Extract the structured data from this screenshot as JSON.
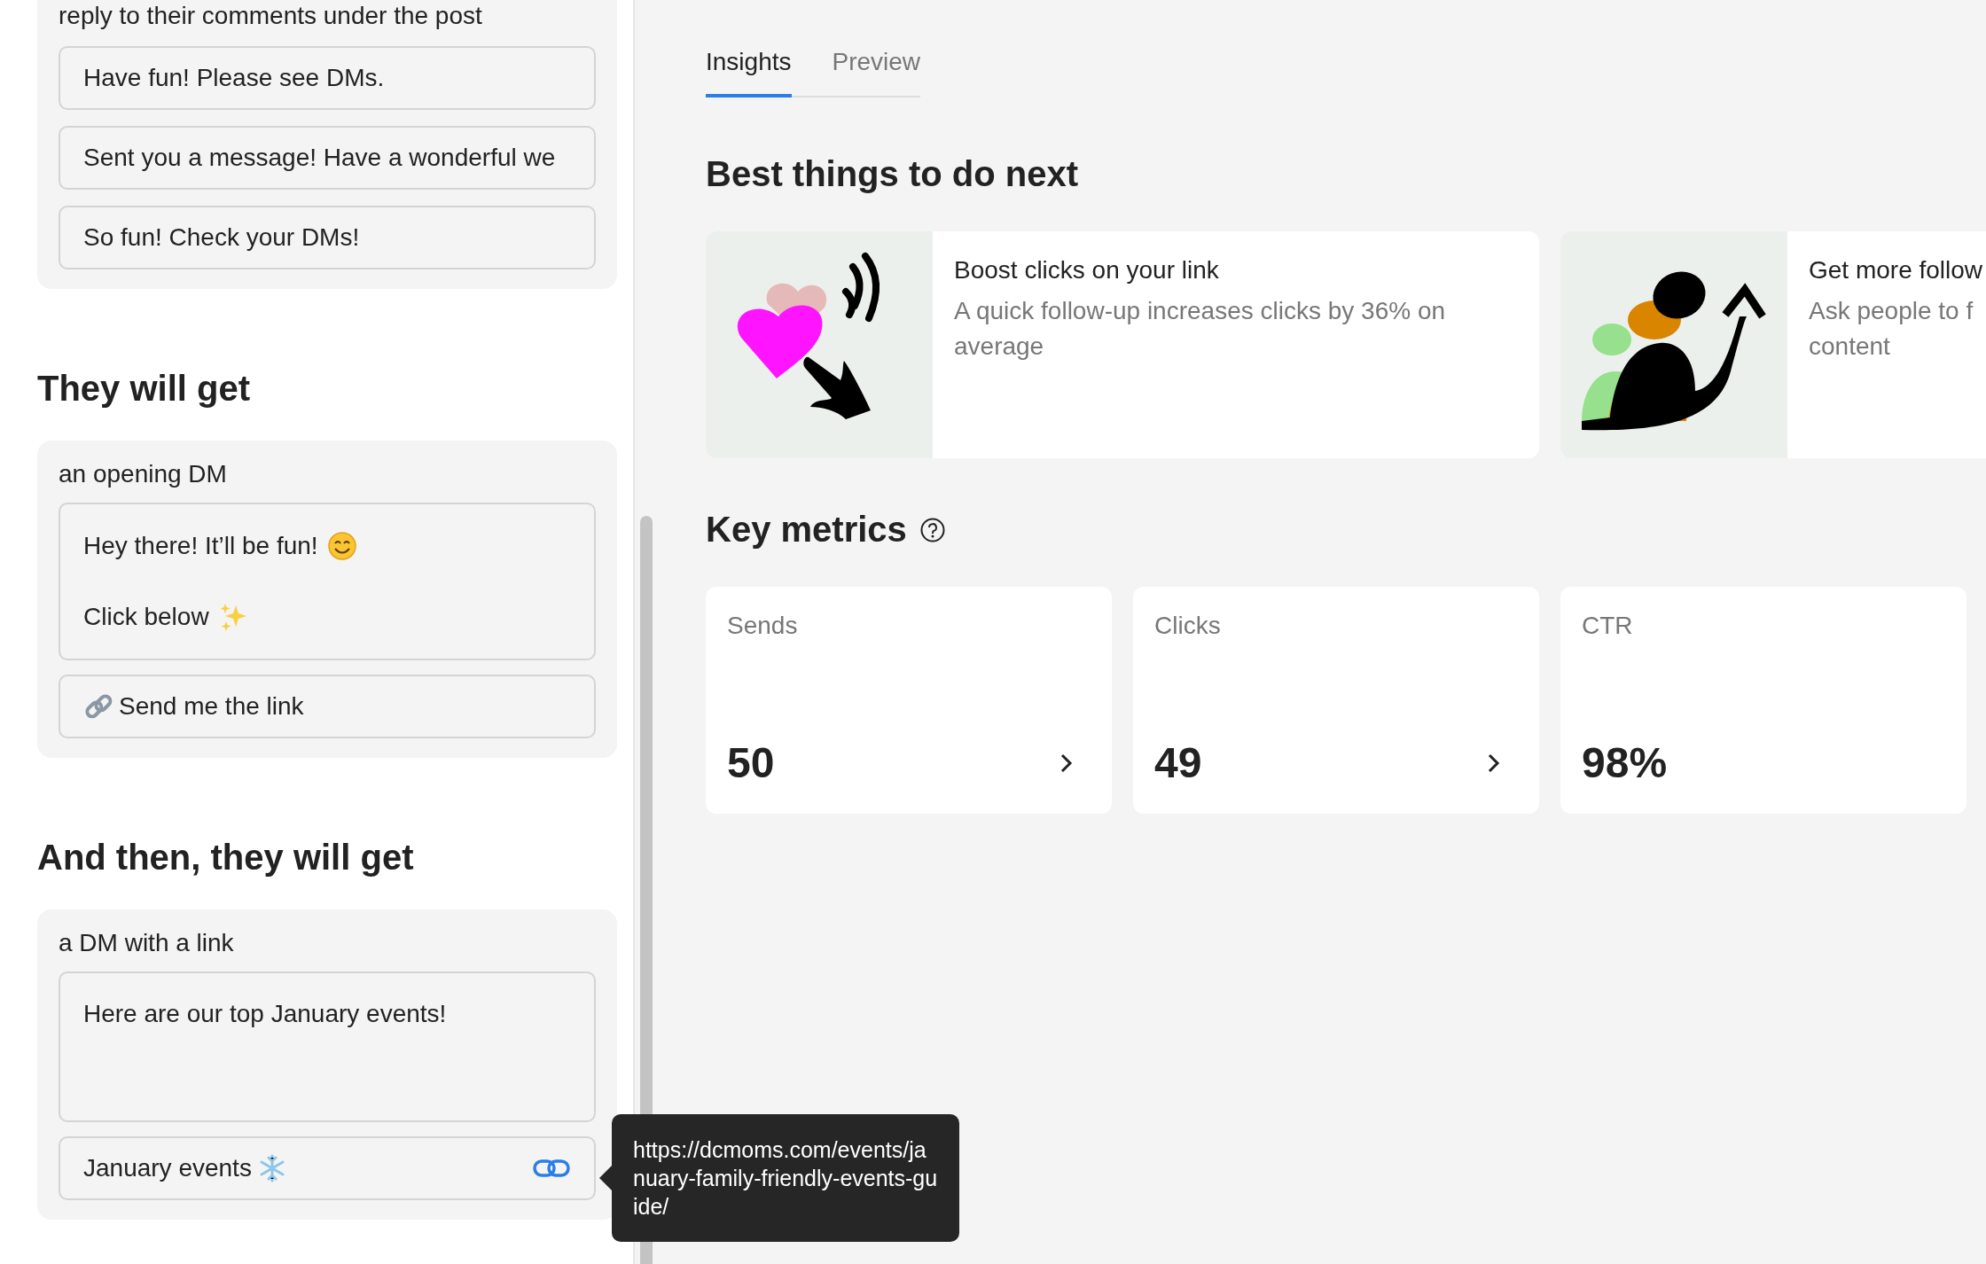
{
  "left_panel": {
    "intro_card": {
      "caption": "reply to their comments under the post",
      "replies": [
        "Have fun! Please see DMs.",
        "Sent you a message! Have a wonderful we",
        "So fun! Check your DMs!"
      ]
    },
    "sections": [
      {
        "heading": "They will get",
        "caption": "an opening DM",
        "message_lines": [
          {
            "text": "Hey there! It’ll be fun!",
            "kind": "smile"
          },
          {
            "text": "Click below",
            "kind": "sparkles"
          }
        ],
        "button": {
          "text": "Send me the link",
          "kind": "chain"
        }
      },
      {
        "heading": "And then, they will get",
        "caption": "a DM with a link",
        "message_lines": [
          {
            "text": "Here are our top January events!",
            "kind": "plain"
          }
        ],
        "button": {
          "text": "January events",
          "kind": "snowflake_link"
        }
      }
    ],
    "tooltip": "https://dcmoms.com/events/january-family-friendly-events-guide/"
  },
  "tabs": [
    {
      "label": "Insights",
      "selected": true
    },
    {
      "label": "Preview",
      "selected": false
    }
  ],
  "suggestions": {
    "heading": "Best things to do next",
    "cards": [
      {
        "kind": "heart",
        "title": "Boost clicks on your link",
        "description_lines": [
          "A quick follow-up increases clicks by 36% on",
          "average"
        ]
      },
      {
        "kind": "people",
        "title": "Get more follow",
        "description_lines": [
          "Ask people to f",
          "content"
        ]
      }
    ]
  },
  "key_metrics": {
    "heading": "Key metrics",
    "metrics": [
      {
        "label": "Sends",
        "value": "50",
        "chevron": true
      },
      {
        "label": "Clicks",
        "value": "49",
        "chevron": true
      },
      {
        "label": "CTR",
        "value": "98%",
        "chevron": false
      }
    ]
  }
}
